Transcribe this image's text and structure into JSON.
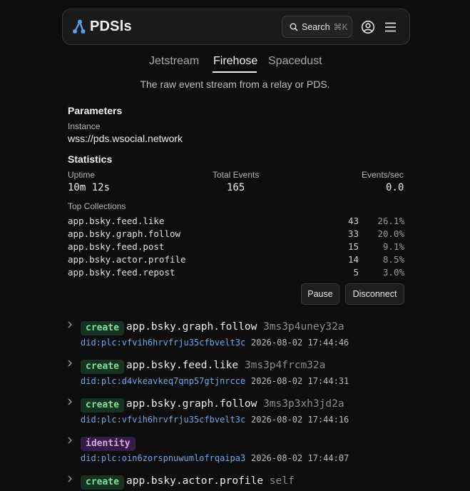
{
  "header": {
    "brand": "PDSls",
    "search_label": "Search",
    "search_shortcut": "⌘K",
    "icons": [
      "pdsls-logo-icon",
      "search-icon",
      "user-circle-icon",
      "hamburger-menu-icon"
    ]
  },
  "tabs": [
    {
      "label": "Jetstream",
      "active": false
    },
    {
      "label": "Firehose",
      "active": true
    },
    {
      "label": "Spacedust",
      "active": false
    }
  ],
  "subtitle": "The raw event stream from a relay or PDS.",
  "parameters": {
    "title": "Parameters",
    "instance_label": "Instance",
    "instance_value": "wss://pds.wsocial.network"
  },
  "statistics": {
    "title": "Statistics",
    "uptime_label": "Uptime",
    "uptime_value": "10m 12s",
    "total_label": "Total Events",
    "total_value": "165",
    "rate_label": "Events/sec",
    "rate_value": "0.0",
    "top_label": "Top Collections",
    "collections": [
      {
        "name": "app.bsky.feed.like",
        "count": "43",
        "pct": "26.1%"
      },
      {
        "name": "app.bsky.graph.follow",
        "count": "33",
        "pct": "20.0%"
      },
      {
        "name": "app.bsky.feed.post",
        "count": "15",
        "pct": "9.1%"
      },
      {
        "name": "app.bsky.actor.profile",
        "count": "14",
        "pct": "8.5%"
      },
      {
        "name": "app.bsky.feed.repost",
        "count": "5",
        "pct": "3.0%"
      }
    ]
  },
  "controls": {
    "pause": "Pause",
    "disconnect": "Disconnect"
  },
  "events": [
    {
      "type": "create",
      "collection": "app.bsky.graph.follow",
      "rkey": "3ms3p4uney32a",
      "did": "did:plc:vfvih6hrvfrju35cfbvelt3c",
      "time": "2026-08-02 17:44:46"
    },
    {
      "type": "create",
      "collection": "app.bsky.feed.like",
      "rkey": "3ms3p4frcm32a",
      "did": "did:plc:d4vkeavkeq7qnp57gtjnrcce",
      "time": "2026-08-02 17:44:31"
    },
    {
      "type": "create",
      "collection": "app.bsky.graph.follow",
      "rkey": "3ms3p3xh3jd2a",
      "did": "did:plc:vfvih6hrvfrju35cfbvelt3c",
      "time": "2026-08-02 17:44:16"
    },
    {
      "type": "identity",
      "collection": "",
      "rkey": "",
      "did": "did:plc:oin6zorspnuwumlofrqaipa3",
      "time": "2026-08-02 17:44:07"
    },
    {
      "type": "create",
      "collection": "app.bsky.actor.profile",
      "rkey": "self",
      "did": "",
      "time": ""
    }
  ],
  "colors": {
    "background": "#0d0d0d",
    "create_badge": "#7ee09a",
    "identity_badge": "#d5a6ee",
    "did_link": "#6fa8e8"
  }
}
